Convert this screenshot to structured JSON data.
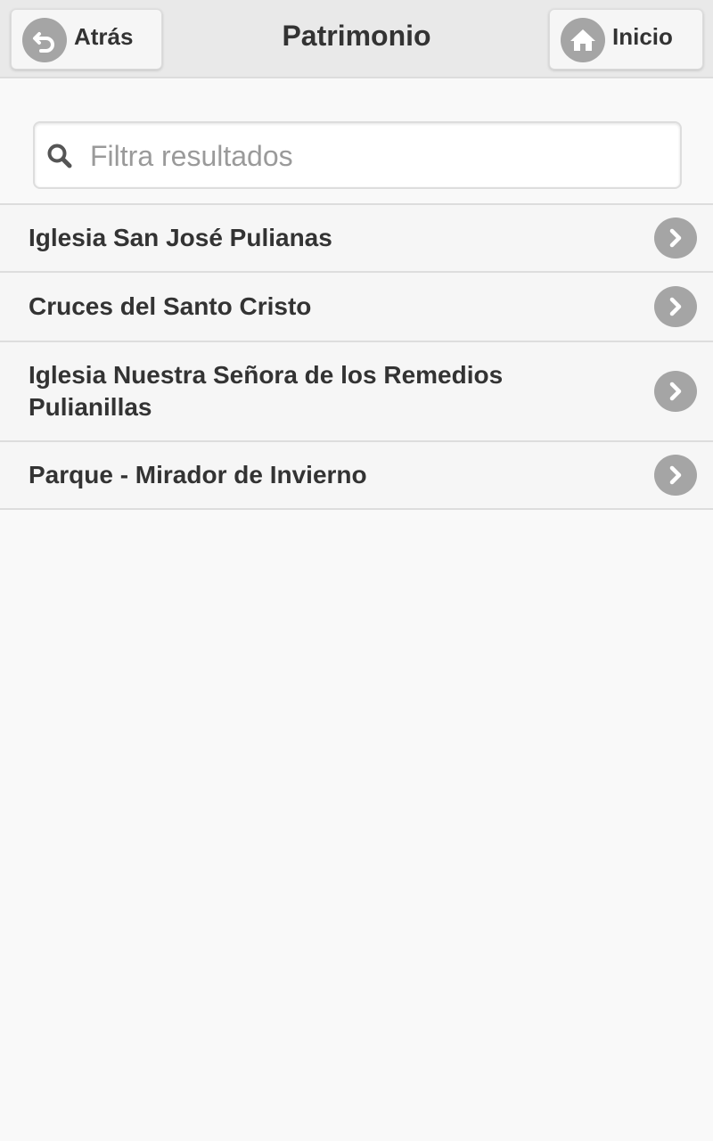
{
  "header": {
    "title": "Patrimonio",
    "back_label": "Atrás",
    "home_label": "Inicio"
  },
  "search": {
    "placeholder": "Filtra resultados",
    "value": ""
  },
  "items": [
    {
      "label": "Iglesia San José Pulianas"
    },
    {
      "label": "Cruces del Santo Cristo"
    },
    {
      "label": "Iglesia Nuestra Señora de los Remedios Pulianillas"
    },
    {
      "label": "Parque - Mirador de Invierno"
    }
  ],
  "colors": {
    "header_bg": "#e9e9e9",
    "icon_circle": "#a5a5a5",
    "text": "#333333",
    "page_bg": "#f9f9f9"
  }
}
